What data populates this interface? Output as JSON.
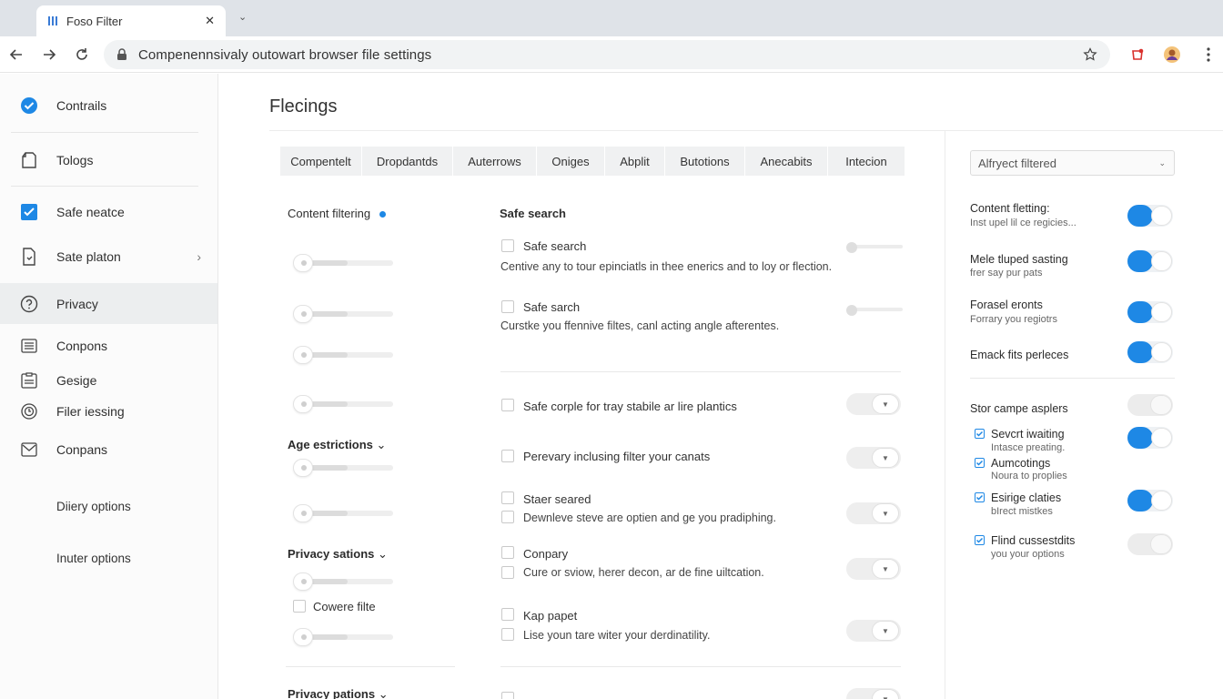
{
  "browser": {
    "tab_title": "Foso Filter",
    "url": "Compenennsivaly outowart browser file settings",
    "icons": [
      "back-icon",
      "forward-icon",
      "reload-icon",
      "lock-icon",
      "star-icon",
      "extension-icon",
      "profile-avatar",
      "menu-icon"
    ]
  },
  "sidebar": {
    "items": [
      {
        "label": "Contrails",
        "icon": "check-circle-icon"
      },
      {
        "label": "Tologs",
        "icon": "document-icon"
      },
      {
        "label": "Safe neatce",
        "icon": "checkbox-icon"
      },
      {
        "label": "Sate platon",
        "icon": "file-icon"
      },
      {
        "label": "Privacy",
        "icon": "question-icon"
      },
      {
        "label": "Conpons",
        "icon": "list-icon"
      },
      {
        "label": "Gesige",
        "icon": "clipboard-icon"
      },
      {
        "label": "Filer iessing",
        "icon": "target-icon"
      },
      {
        "label": "Conpans",
        "icon": "mail-icon"
      },
      {
        "label": "Diiery options"
      },
      {
        "label": "Inuter options"
      }
    ]
  },
  "main": {
    "title": "Flecings",
    "tabs": [
      "Compentelt",
      "Dropdantds",
      "Auterrows",
      "Oniges",
      "Abplit",
      "Butotions",
      "Anecabits",
      "Intecion"
    ],
    "left": {
      "content_filtering": "Content filtering",
      "age_restrictions": "Age estrictions",
      "privacy_sations": "Privacy sations",
      "cowere_filte": "Cowere filte",
      "privacy_pations": "Privacy pations"
    },
    "safe_search_heading": "Safe search",
    "rows": [
      {
        "title": "Safe search",
        "desc": "Centive any to tour epinciatls in thee enerics and to loy or flection."
      },
      {
        "title": "Safe sarch",
        "desc": "Curstke you ffennive filtes, canl acting angle afterentes."
      },
      {
        "title": "Safe corple for tray stabile ar lire plantics"
      },
      {
        "title": "Perevary inclusing filter your canats"
      },
      {
        "title": "Staer seared",
        "desc": "Dewnleve steve are optien and ge you pradiphing."
      },
      {
        "title": "Conpary",
        "desc": "Cure or sviow, herer decon, ar de fine uiltcation."
      },
      {
        "title": "Kap papet",
        "desc": "Lise youn tare witer your derdinatility."
      }
    ]
  },
  "right_panel": {
    "select_value": "Alfryect filtered",
    "items": [
      {
        "title": "Content fletting:",
        "sub": "Inst upel lil ce regicies...",
        "toggle": "on"
      },
      {
        "title": "Mele tluped sasting",
        "sub": "frer say pur pats",
        "toggle": "on"
      },
      {
        "title": "Forasel eronts",
        "sub": "Forrary you regiotrs",
        "toggle": "on"
      },
      {
        "title": "Emack fits perleces",
        "sub": "",
        "toggle": "on"
      },
      {
        "title": "Stor campe asplers",
        "sub": "",
        "toggle": "off"
      }
    ],
    "checks": [
      {
        "title": "Sevcrt iwaiting",
        "sub": "Intasce preating.",
        "toggle": "on"
      },
      {
        "title": "Aumcotings",
        "sub": "Noura to proplies",
        "toggle": null
      },
      {
        "title": "Esirige claties",
        "sub": "bIrect mistkes",
        "toggle": "on"
      },
      {
        "title": "Flind cussestdits",
        "sub": "you your options",
        "toggle": "off"
      }
    ]
  },
  "colors": {
    "accent": "#1e88e5",
    "sidebar_active": "#eceeef",
    "tab_bg": "#f0f1f2"
  }
}
